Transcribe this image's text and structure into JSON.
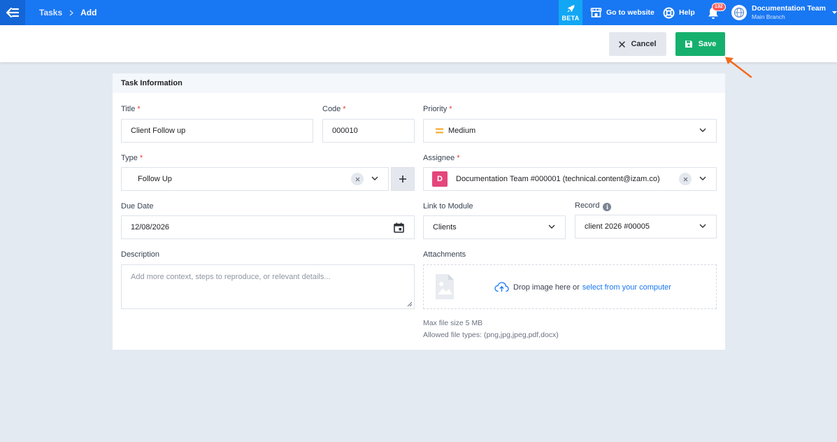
{
  "breadcrumb": {
    "parent": "Tasks",
    "current": "Add"
  },
  "topbar": {
    "beta_label": "BETA",
    "website_label": "Go to website",
    "help_label": "Help",
    "notification_count": "132",
    "account_name": "Documentation Team",
    "account_branch": "Main Branch"
  },
  "actions": {
    "cancel_label": "Cancel",
    "save_label": "Save"
  },
  "form": {
    "section_title": "Task Information",
    "title": {
      "label": "Title",
      "required": "*",
      "value": "Client Follow up"
    },
    "code": {
      "label": "Code",
      "required": "*",
      "value": "000010"
    },
    "priority": {
      "label": "Priority",
      "required": "*",
      "value": "Medium"
    },
    "type": {
      "label": "Type",
      "required": "*",
      "value": "Follow Up"
    },
    "assignee": {
      "label": "Assignee",
      "required": "*",
      "initial": "D",
      "value": "Documentation Team #000001 (technical.content@izam.co)"
    },
    "due_date": {
      "label": "Due Date",
      "value": "12/08/2026"
    },
    "link_module": {
      "label": "Link to Module",
      "value": "Clients"
    },
    "record": {
      "label": "Record",
      "info": "i",
      "value": "client 2026 #00005"
    },
    "description": {
      "label": "Description",
      "placeholder": "Add more context, steps to reproduce, or relevant details..."
    },
    "attachments": {
      "label": "Attachments",
      "drop_text": "Drop image here or",
      "select_link": "select from your computer",
      "max_size": "Max file size 5 MB",
      "allowed_types": "Allowed file types: (png,jpg,jpeg,pdf,docx)"
    }
  },
  "colors": {
    "topbar": "#1877f2",
    "beta": "#12a7f5",
    "save": "#16b06e",
    "cancel": "#e4e8ee",
    "priority_medium": "#f5a623",
    "required": "#e53935",
    "avatar": "#e4467b",
    "annotation_arrow": "#f26a1b"
  },
  "icons": {
    "menu": "arrow-left-menu-icon",
    "beta": "rocket-icon",
    "website": "store-icon",
    "help": "lifebuoy-icon",
    "notifications": "bell-icon",
    "cancel": "close-icon",
    "save": "floppy-disk-icon",
    "date": "calendar-icon",
    "upload": "cloud-upload-icon"
  }
}
